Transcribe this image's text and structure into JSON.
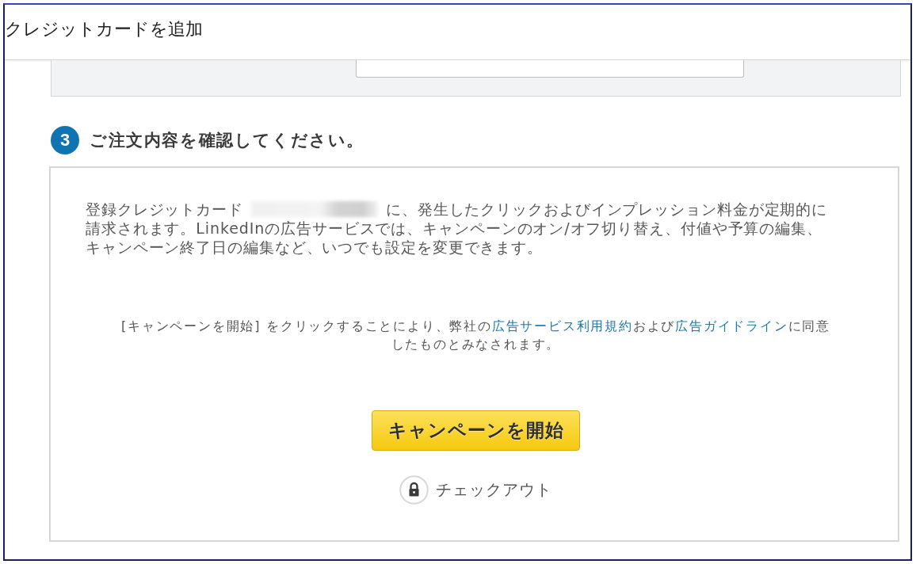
{
  "dialog": {
    "title": "クレジットカードを追加"
  },
  "step": {
    "number": "3",
    "title": "ご注文内容を確認してください。"
  },
  "summary": {
    "text_before": "登録クレジットカード",
    "text_after": "に、発生したクリックおよびインプレッション料金が定期的に請求されます。LinkedInの広告サービスでは、キャンペーンのオン/オフ切り替え、付値や予算の編集、キャンペーン終了日の編集など、いつでも設定を変更できます。"
  },
  "agreement": {
    "parts": [
      {
        "kind": "text",
        "text": "[キャンペーンを開始] をクリックすることにより、弊社の"
      },
      {
        "kind": "link",
        "text": "広告サービス利用規約"
      },
      {
        "kind": "text",
        "text": "および"
      },
      {
        "kind": "link",
        "text": "広告ガイドライン"
      },
      {
        "kind": "text",
        "text": "に同意したものとみなされます。"
      }
    ]
  },
  "primary_button": {
    "label": "キャンペーンを開始"
  },
  "checkout": {
    "label": "チェックアウト"
  }
}
